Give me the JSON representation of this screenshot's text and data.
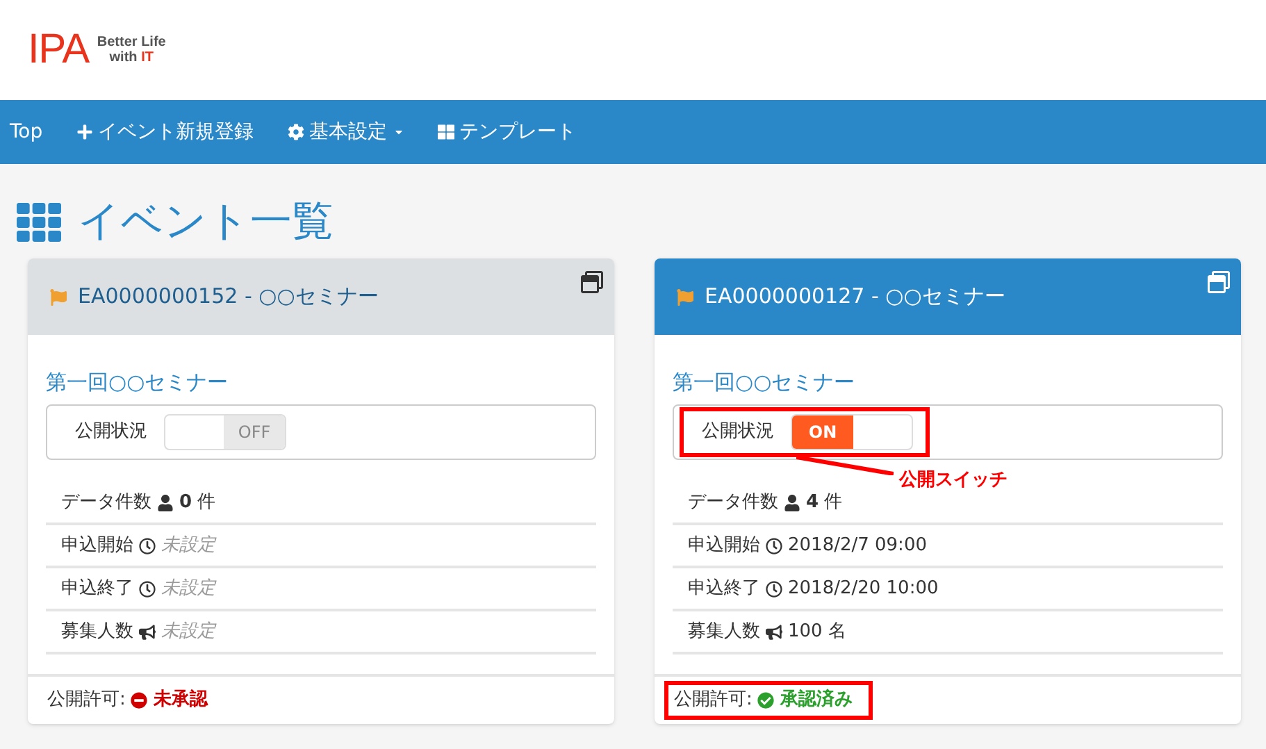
{
  "logo": {
    "mark": "IPA",
    "tagline_1": "Better Life",
    "tagline_2": "with ",
    "tagline_accent": "IT"
  },
  "nav": [
    {
      "label": "Top",
      "kind": "home",
      "dropdown": false
    },
    {
      "label": "イベント新規登録",
      "kind": "create",
      "dropdown": false
    },
    {
      "label": "基本設定",
      "kind": "settings",
      "dropdown": true
    },
    {
      "label": "テンプレート",
      "kind": "templates",
      "dropdown": false
    }
  ],
  "page_title": "イベント一覧",
  "cards": [
    {
      "header": "EA0000000152 - ○○セミナー",
      "highlighted": false,
      "event_link": "第一回○○セミナー",
      "switch_label": "公開状況",
      "switch": {
        "on": false,
        "text": "OFF",
        "annotated": false
      },
      "rows": [
        {
          "label": "データ件数",
          "kind": "count",
          "value": "**0** 件",
          "unset": false
        },
        {
          "label": "申込開始",
          "kind": "date",
          "value": "未設定",
          "unset": true
        },
        {
          "label": "申込終了",
          "kind": "date",
          "value": "未設定",
          "unset": true
        },
        {
          "label": "募集人数",
          "kind": "capacity",
          "value": "未設定",
          "unset": true
        }
      ],
      "permit": {
        "label": "公開許可:",
        "approved": false,
        "text": "未承認",
        "annotated": false
      }
    },
    {
      "header": "EA0000000127 - ○○セミナー",
      "highlighted": true,
      "event_link": "第一回○○セミナー",
      "switch_label": "公開状況",
      "switch": {
        "on": true,
        "text": "ON",
        "annotated": true,
        "callout": "公開スイッチ"
      },
      "rows": [
        {
          "label": "データ件数",
          "kind": "count",
          "value": "**4** 件",
          "unset": false
        },
        {
          "label": "申込開始",
          "kind": "date",
          "value": "2018/2/7 09:00",
          "unset": false
        },
        {
          "label": "申込終了",
          "kind": "date",
          "value": "2018/2/20 10:00",
          "unset": false
        },
        {
          "label": "募集人数",
          "kind": "capacity",
          "value": "100 名",
          "unset": false
        }
      ],
      "permit": {
        "label": "公開許可:",
        "approved": true,
        "text": "承認済み",
        "annotated": true
      }
    }
  ]
}
